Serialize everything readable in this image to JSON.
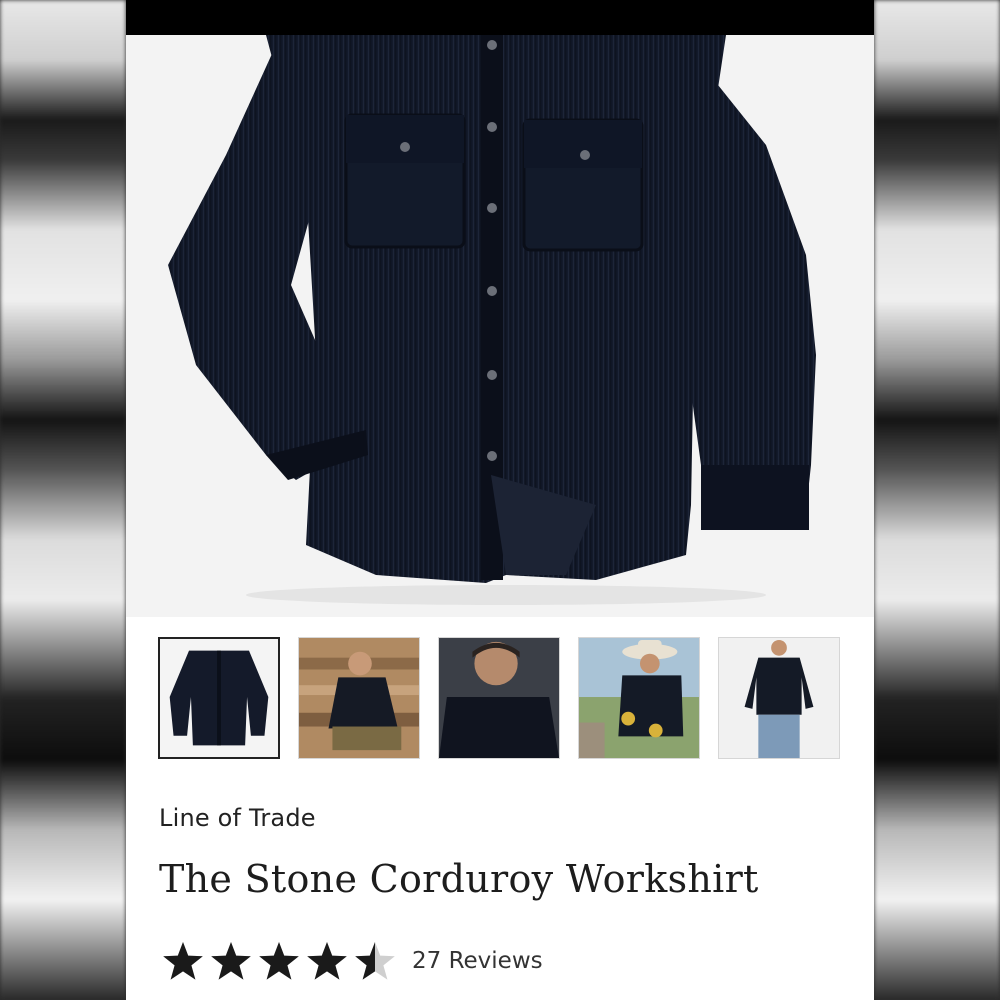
{
  "product": {
    "brand": "Line of Trade",
    "title": "The Stone Corduroy Workshirt",
    "rating": 4.5,
    "rating_max": 5,
    "reviews_label": "27 Reviews"
  },
  "gallery": {
    "thumbnails": [
      {
        "name": "thumb-shirt-flatlay",
        "selected": true
      },
      {
        "name": "thumb-model-seated-lumber",
        "selected": false
      },
      {
        "name": "thumb-model-closeup",
        "selected": false
      },
      {
        "name": "thumb-model-cowboy-hat",
        "selected": false
      },
      {
        "name": "thumb-model-standing",
        "selected": false
      }
    ]
  },
  "colors": {
    "shirt": "#111827",
    "star": "#1a1a1a",
    "star_empty": "#cfcfcf"
  }
}
